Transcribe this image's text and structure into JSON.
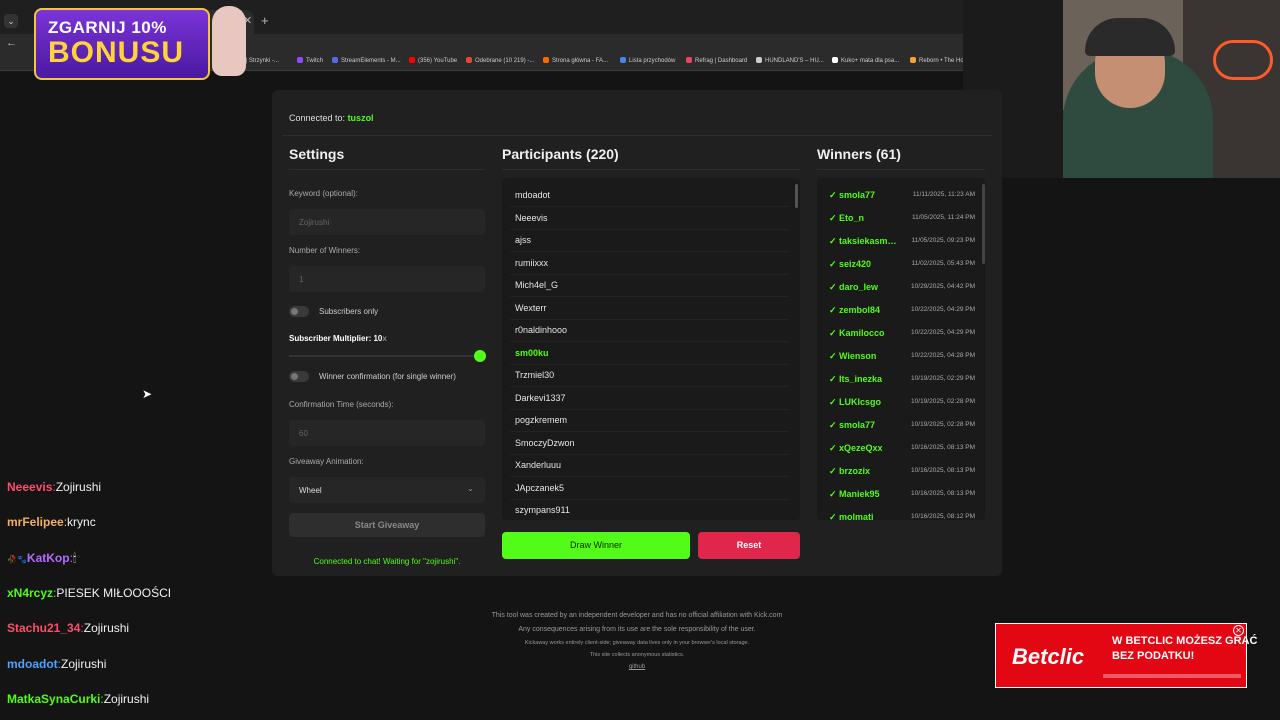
{
  "browser": {
    "tab_menu": "⌄",
    "tab_close": "✕",
    "tab_new": "+",
    "back": "←",
    "bookmarks": [
      {
        "label": "ions | Strzynki -...",
        "color": "#777777"
      },
      {
        "label": "Twitch",
        "color": "#9146ff"
      },
      {
        "label": "StreamElements - M...",
        "color": "#4f6bf5"
      },
      {
        "label": "(356) YouTube",
        "color": "#ff0000"
      },
      {
        "label": "Odebrane (10 219) -...",
        "color": "#ea4335"
      },
      {
        "label": "Strona główna - FA...",
        "color": "#ff6600"
      },
      {
        "label": "Lista przychodów",
        "color": "#4285f4"
      },
      {
        "label": "Refrag | Dashboard",
        "color": "#e94560"
      },
      {
        "label": "HUNDLAND'S – HU...",
        "color": "#cccccc"
      },
      {
        "label": "Kuko+ mata dla psa...",
        "color": "#ffffff"
      },
      {
        "label": "Reborn • The Ho",
        "color": "#f4a13a"
      }
    ]
  },
  "bonus": {
    "line1": "ZGARNIJ 10%",
    "line2": "BONUSU"
  },
  "app": {
    "connected_label": "Connected to:",
    "connected_channel": "tuszol",
    "settings": {
      "title": "Settings",
      "keyword_label": "Keyword (optional):",
      "keyword_value": "Zojirushi",
      "winners_label": "Number of Winners:",
      "winners_value": "1",
      "subs_only_label": "Subscribers only",
      "multiplier_label": "Subscriber Multiplier:",
      "multiplier_value": "10",
      "multiplier_unit": "x",
      "multiplier_level": 1.0,
      "confirm_label": "Winner confirmation (for single winner)",
      "confirm_time_label": "Confirmation Time (seconds):",
      "confirm_time_value": "60",
      "animation_label": "Giveaway Animation:",
      "animation_value": "Wheel",
      "start_button": "Start Giveaway",
      "status": "Connected to chat! Waiting for \"zojirushi\"."
    },
    "participants": {
      "title": "Participants (220)",
      "items": [
        "mdoadot",
        "Neeevis",
        "ajss",
        "rumiixxx",
        "Mich4el_G",
        "Wexterr",
        "r0naldinhooo",
        "sm00ku",
        "Trzmiel30",
        "Darkevi1337",
        "pogzkremem",
        "SmoczyDzwon",
        "Xanderluuu",
        "JApczanek5",
        "szympans911"
      ],
      "highlighted": "sm00ku",
      "draw_button": "Draw Winner",
      "reset_button": "Reset"
    },
    "winners": {
      "title": "Winners (61)",
      "check": "✓",
      "items": [
        {
          "name": "smola77",
          "date": "11/11/2025, 11:23 AM"
        },
        {
          "name": "Eto_n",
          "date": "11/05/2025, 11:24 PM"
        },
        {
          "name": "taksiekasmakuje",
          "date": "11/05/2025, 09:23 PM"
        },
        {
          "name": "seiz420",
          "date": "11/02/2025, 05:43 PM"
        },
        {
          "name": "daro_lew",
          "date": "10/29/2025, 04:42 PM"
        },
        {
          "name": "zembol84",
          "date": "10/22/2025, 04:29 PM"
        },
        {
          "name": "Kamilocco",
          "date": "10/22/2025, 04:29 PM"
        },
        {
          "name": "Wienson",
          "date": "10/22/2025, 04:28 PM"
        },
        {
          "name": "Its_inezka",
          "date": "10/19/2025, 02:29 PM"
        },
        {
          "name": "LUKIcsgo",
          "date": "10/19/2025, 02:28 PM"
        },
        {
          "name": "smola77",
          "date": "10/19/2025, 02:28 PM"
        },
        {
          "name": "xQezeQxx",
          "date": "10/16/2025, 08:13 PM"
        },
        {
          "name": "brzozix",
          "date": "10/16/2025, 08:13 PM"
        },
        {
          "name": "Maniek95",
          "date": "10/16/2025, 08:13 PM"
        },
        {
          "name": "molmati",
          "date": "10/16/2025, 08:12 PM"
        }
      ]
    },
    "footer": {
      "line1": "This tool was created by an independent developer and has no official affiliation with Kick.com",
      "line2": "Any consequences arising from its use are the sole responsibility of the user.",
      "line3": "Kickaway works entirely client-side; giveaway data lives only in your browser's local storage.",
      "line4": "This site collects anonymous statistics.",
      "link": "github"
    }
  },
  "chat": [
    {
      "user": "Neeevis",
      "color": "#ff4d6a",
      "msg": "Zojirushi",
      "prefix": ""
    },
    {
      "user": "mrFelipee",
      "color": "#f0b060",
      "msg": "krync",
      "prefix": ""
    },
    {
      "user": "KatKop",
      "color": "#b36bff",
      "msg": "🕯",
      "prefix": "🥀🐾"
    },
    {
      "user": "xN4rcyz",
      "color": "#53fc18",
      "msg": "PIESEK MIŁOOOŚCI",
      "prefix": ""
    },
    {
      "user": "Stachu21_34",
      "color": "#ff4d6a",
      "msg": "Zojirushi",
      "prefix": ""
    },
    {
      "user": "mdoadot",
      "color": "#4da3ff",
      "msg": "Zojirushi",
      "prefix": ""
    },
    {
      "user": "MatkaSynaCurki",
      "color": "#53fc18",
      "msg": "Zojirushi",
      "prefix": ""
    }
  ],
  "betclic": {
    "logo": "Betclic",
    "line1": "W BETCLIC MOŻESZ GRAĆ",
    "line2": "BEZ PODATKU!",
    "close": "✕"
  },
  "cursor": "➤"
}
